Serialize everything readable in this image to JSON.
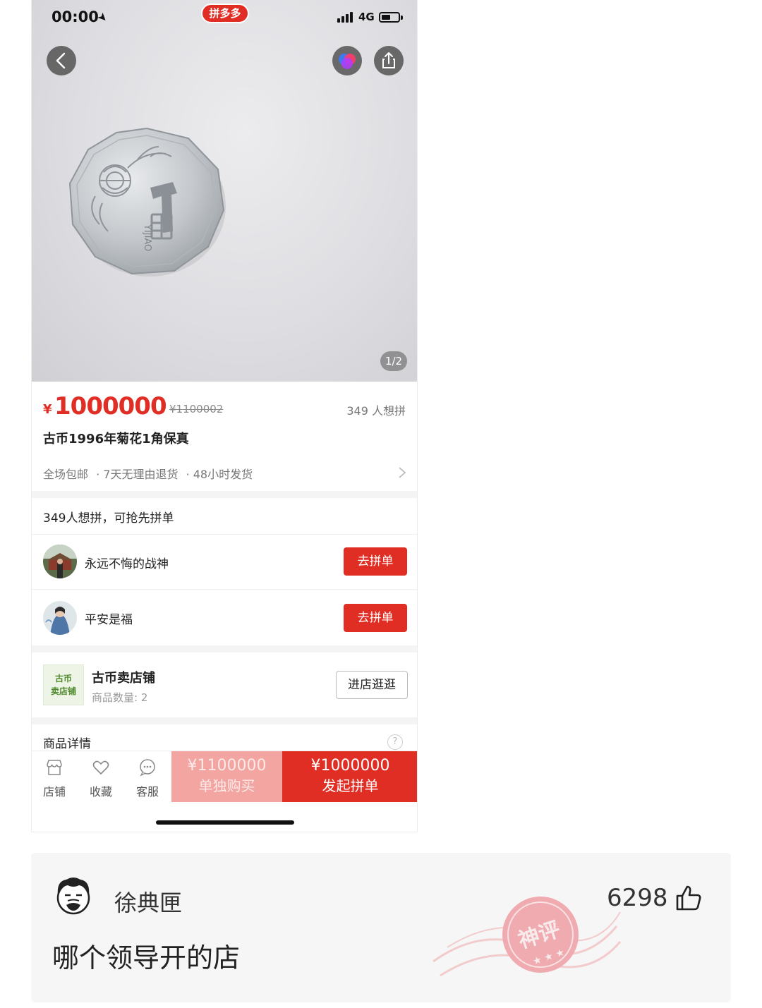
{
  "status_bar": {
    "time": "00:00",
    "network": "4G",
    "app_badge": "拼多多"
  },
  "gallery": {
    "page_indicator": "1/2"
  },
  "product": {
    "currency": "¥",
    "price": "1000000",
    "original_price": "¥1100002",
    "want_count": "349 人想拼",
    "title": "古币1996年菊花1角保真",
    "services": [
      "全场包邮",
      "· 7天无理由退货",
      "· 48小时发货"
    ]
  },
  "group_buy": {
    "header": "349人想拼，可抢先拼单",
    "join_label": "去拼单",
    "groups": [
      {
        "name": "永远不悔的战神"
      },
      {
        "name": "平安是福"
      }
    ]
  },
  "shop": {
    "logo_text": "古币 卖店铺",
    "name": "古币卖店铺",
    "product_count": "商品数量: 2",
    "visit_label": "进店逛逛"
  },
  "details": {
    "header": "商品详情",
    "help": "?"
  },
  "bottom_bar": {
    "tabs": [
      {
        "label": "店铺",
        "icon": "store-icon"
      },
      {
        "label": "收藏",
        "icon": "heart-icon"
      },
      {
        "label": "客服",
        "icon": "chat-icon"
      }
    ],
    "solo": {
      "price": "¥1100000",
      "label": "单独购买"
    },
    "group": {
      "price": "¥1000000",
      "label": "发起拼单"
    }
  },
  "comment": {
    "username": "徐典匣",
    "likes": "6298",
    "text": "哪个领导开的店",
    "stamp_text": "神评"
  },
  "colors": {
    "accent": "#e02e24",
    "accent_light": "#f2a5a1"
  }
}
